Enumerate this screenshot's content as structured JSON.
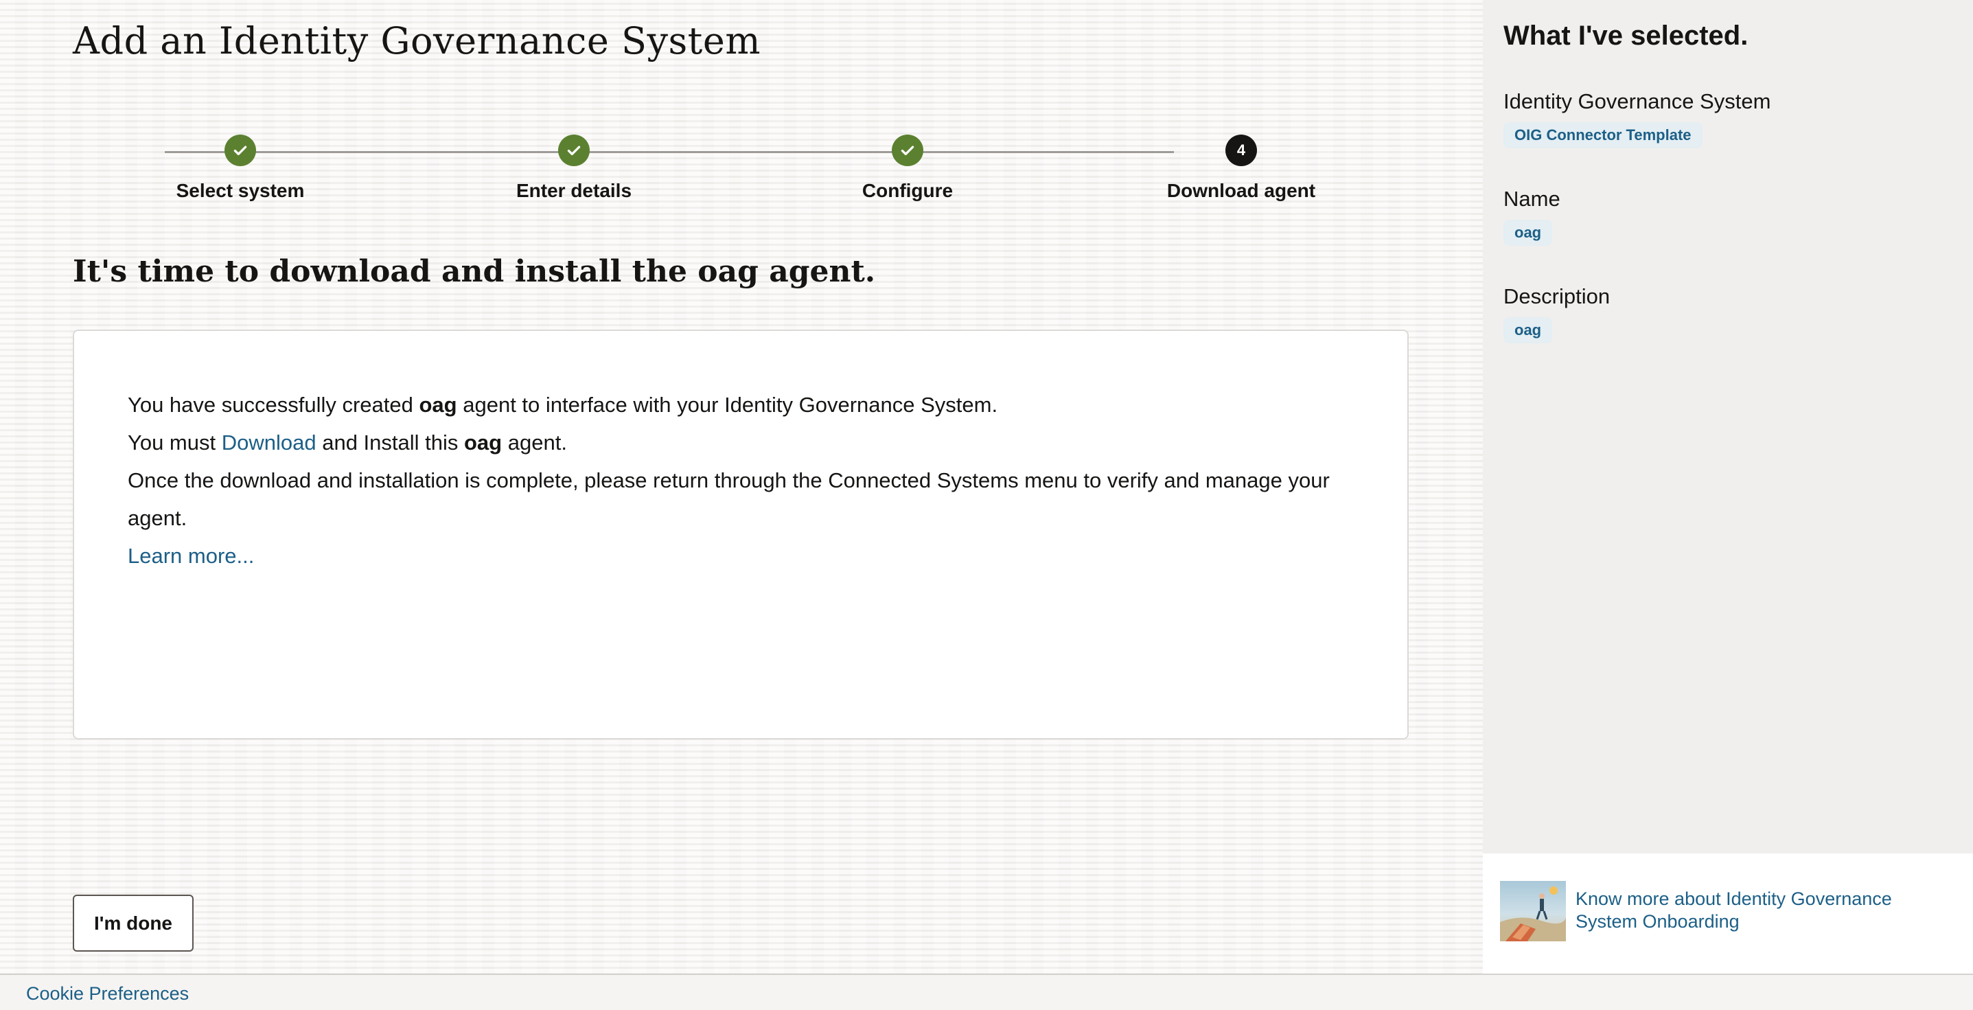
{
  "page": {
    "title": "Add an Identity Governance System",
    "subtitle": "It's time to download and install the oag agent."
  },
  "stepper": {
    "steps": [
      {
        "label": "Select system",
        "state": "done"
      },
      {
        "label": "Enter details",
        "state": "done"
      },
      {
        "label": "Configure",
        "state": "done"
      },
      {
        "label": "Download agent",
        "state": "current",
        "number": "4"
      }
    ]
  },
  "card": {
    "line1_prefix": "You have successfully created ",
    "line1_bold": "oag",
    "line1_suffix": " agent to interface with your Identity Governance System.",
    "line2_prefix": "You must ",
    "line2_link": "Download",
    "line2_middle": " and Install this ",
    "line2_bold": "oag",
    "line2_suffix": " agent.",
    "line3": "Once the download and installation is complete, please return through the Connected Systems menu to verify and manage your agent.",
    "learn_more": "Learn more..."
  },
  "actions": {
    "done_label": "I'm done"
  },
  "summary": {
    "heading": "What I've selected.",
    "items": [
      {
        "label": "Identity Governance System",
        "value": "OIG Connector Template"
      },
      {
        "label": "Name",
        "value": "oag"
      },
      {
        "label": "Description",
        "value": "oag"
      }
    ]
  },
  "promo": {
    "link_text": "Know more about Identity Governance System Onboarding",
    "thumb_icon": "onboarding-illustration-icon"
  },
  "footer": {
    "cookie_label": "Cookie Preferences"
  },
  "colors": {
    "success_green": "#5b8130",
    "link_blue": "#1c5f87",
    "chip_bg": "#e4eef3",
    "side_panel_bg": "#f1efed"
  }
}
